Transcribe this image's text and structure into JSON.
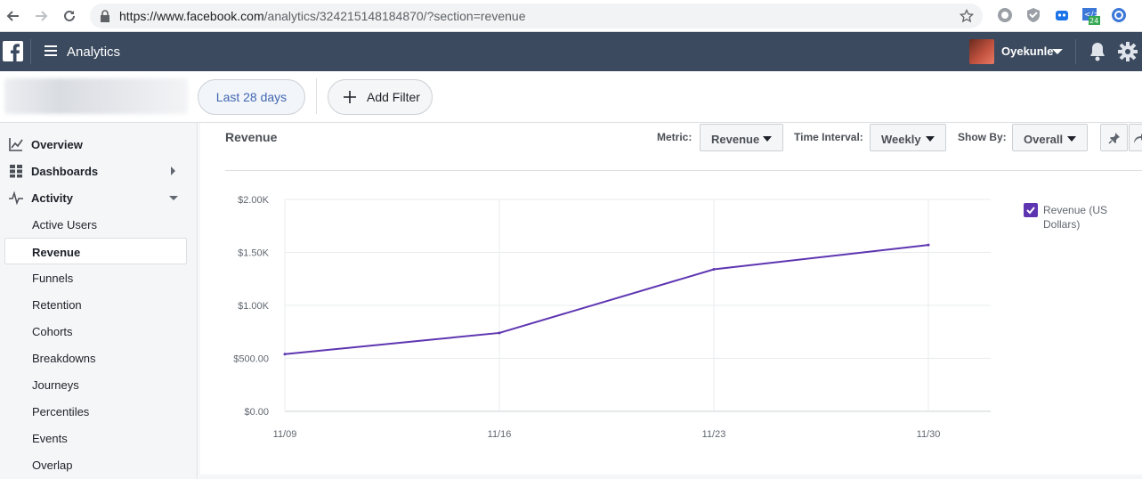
{
  "browser": {
    "url_host": "https://www.facebook.com",
    "url_path": "/analytics/324215148184870/?section=revenue"
  },
  "topbar": {
    "title": "Analytics",
    "user_name": "Oyekunle"
  },
  "filters": {
    "date_range": "Last 28 days",
    "add_filter": "Add Filter"
  },
  "sidebar": {
    "items": [
      {
        "label": "Overview",
        "icon": "overview-chart-icon"
      },
      {
        "label": "Dashboards",
        "icon": "dashboards-grid-icon"
      },
      {
        "label": "Activity",
        "icon": "activity-pulse-icon"
      }
    ],
    "activity_items": [
      "Active Users",
      "Revenue",
      "Funnels",
      "Retention",
      "Cohorts",
      "Breakdowns",
      "Journeys",
      "Percentiles",
      "Events",
      "Overlap"
    ],
    "active_item": "Revenue"
  },
  "panel": {
    "title": "Revenue",
    "metric_label": "Metric:",
    "metric_value": "Revenue",
    "interval_label": "Time Interval:",
    "interval_value": "Weekly",
    "showby_label": "Show By:",
    "showby_value": "Overall"
  },
  "chart_data": {
    "type": "line",
    "categories": [
      "11/09",
      "11/16",
      "11/23",
      "11/30"
    ],
    "series": [
      {
        "name": "Revenue (US Dollars)",
        "values": [
          540,
          740,
          1340,
          1570
        ],
        "color": "#5e35b1"
      }
    ],
    "yticks": [
      "$0.00",
      "$500.00",
      "$1.00K",
      "$1.50K",
      "$2.00K"
    ],
    "ylim": [
      0,
      2000
    ],
    "grid": true,
    "legend_position": "right"
  }
}
